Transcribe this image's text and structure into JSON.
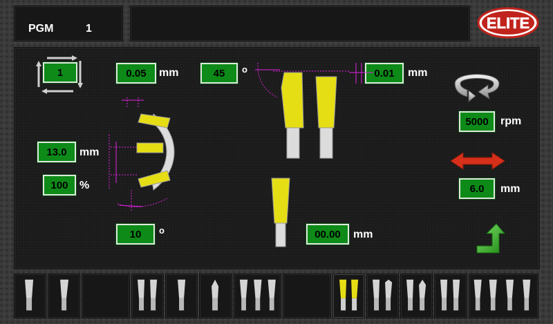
{
  "header": {
    "pgm_label": "PGM",
    "pgm_number": "1",
    "message": "",
    "logo_text": "ELITE"
  },
  "fields": {
    "cycles": "1",
    "thickness": "0.05",
    "thickness_unit": "mm",
    "angle_top": "45",
    "angle_top_unit": "o",
    "offset": "0.01",
    "offset_unit": "mm",
    "radius": "13.0",
    "radius_unit": "mm",
    "percent": "100",
    "percent_unit": "%",
    "angle_bottom": "10",
    "angle_bottom_unit": "o",
    "length": "00.00",
    "length_unit": "mm",
    "speed": "5000",
    "speed_unit": "rpm",
    "stroke": "6.0",
    "stroke_unit": "mm"
  },
  "icons": [
    "cycle-arrows-icon",
    "rotation-icon",
    "stroke-arrow-icon",
    "next-arrow-icon",
    "logo-icon"
  ],
  "colors": {
    "field_green": "#0d8a18",
    "blade_yellow": "#e6de14",
    "dimension_magenta": "#e020e0",
    "arrow_red": "#d6301a",
    "arrow_green": "#3cbf2a"
  },
  "thumbnails": [
    {
      "id": "t1",
      "blades": 1,
      "selected": false
    },
    {
      "id": "t2",
      "blades": 1,
      "selected": false
    },
    {
      "id": "t3",
      "blades": 0,
      "selected": false
    },
    {
      "id": "t4",
      "blades": 2,
      "selected": false
    },
    {
      "id": "t5",
      "blades": 1,
      "selected": false
    },
    {
      "id": "t6",
      "blades": 1,
      "selected": false
    },
    {
      "id": "t7",
      "blades": 3,
      "selected": false
    },
    {
      "id": "t8",
      "blades": 0,
      "selected": false
    },
    {
      "id": "t9",
      "blades": 2,
      "selected": true
    },
    {
      "id": "t10",
      "blades": 2,
      "selected": false
    },
    {
      "id": "t11",
      "blades": 2,
      "selected": false
    },
    {
      "id": "t12",
      "blades": 2,
      "selected": false
    },
    {
      "id": "t13",
      "blades": 4,
      "selected": false
    }
  ]
}
